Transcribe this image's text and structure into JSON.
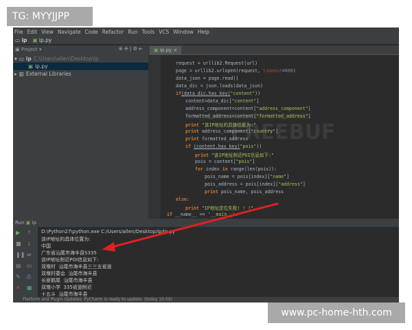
{
  "menu": [
    "File",
    "Edit",
    "View",
    "Navigate",
    "Code",
    "Refactor",
    "Run",
    "Tools",
    "VCS",
    "Window",
    "Help"
  ],
  "nav": {
    "folder": "ip",
    "file": "ip.py"
  },
  "project": {
    "label": "Project",
    "root": "ip",
    "root_path": "C:\\Users\\allen\\Desktop\\ip",
    "file": "ip.py",
    "libs": "External Libraries"
  },
  "editor_tab": "ip.py",
  "code": [
    {
      "i": 1,
      "s": [
        [
          "request = urllib2.Request(url)",
          ""
        ]
      ]
    },
    {
      "i": 1,
      "s": [
        [
          "page = urllib2.urlopen(request, ",
          ""
        ],
        [
          "timeout",
          "param"
        ],
        [
          "=",
          ""
        ],
        [
          "600",
          "num"
        ],
        [
          ")",
          ""
        ]
      ]
    },
    {
      "i": 1,
      "s": [
        [
          "data_json = page.read()",
          ""
        ]
      ]
    },
    {
      "i": 1,
      "s": [
        [
          "data_dic = json.loads(data_json)",
          ""
        ]
      ]
    },
    {
      "i": 1,
      "s": [
        [
          "if",
          "kw"
        ],
        [
          "(data_dic.has_key(",
          "un"
        ],
        [
          "\"content\"",
          "str"
        ],
        [
          "))",
          ""
        ]
      ]
    },
    {
      "i": 2,
      "s": [
        [
          "content=data_dic[",
          ""
        ],
        [
          "\"content\"",
          "str"
        ],
        [
          "]",
          ""
        ]
      ]
    },
    {
      "i": 2,
      "s": [
        [
          "address_component=content[",
          ""
        ],
        [
          "\"address_component\"",
          "str"
        ],
        [
          "]",
          ""
        ]
      ]
    },
    {
      "i": 2,
      "s": [
        [
          "formatted_address=content[",
          ""
        ],
        [
          "\"formatted_address\"",
          "str"
        ],
        [
          "]",
          ""
        ]
      ],
      "hl": true
    },
    {
      "i": 2,
      "s": [
        [
          "print ",
          "kw"
        ],
        [
          "\"该IP地址的具体位置为:\"",
          "str"
        ]
      ]
    },
    {
      "i": 2,
      "s": [
        [
          "print ",
          "kw"
        ],
        [
          "address_component[",
          ""
        ],
        [
          "\"country\"",
          "str"
        ],
        [
          "]",
          ""
        ]
      ]
    },
    {
      "i": 2,
      "s": [
        [
          "print ",
          "kw"
        ],
        [
          "formatted_address",
          ""
        ]
      ]
    },
    {
      "i": 2,
      "s": [
        [
          "if ",
          "kw"
        ],
        [
          "(content.has_key(",
          "un"
        ],
        [
          "\"pois\"",
          "str"
        ],
        [
          "))",
          ""
        ]
      ]
    },
    {
      "i": 3,
      "s": [
        [
          "print ",
          "kw"
        ],
        [
          "\"该IP地址附近POI信息如下:\"",
          "str"
        ]
      ]
    },
    {
      "i": 3,
      "s": [
        [
          "pois = content[",
          ""
        ],
        [
          "\"pois\"",
          "str"
        ],
        [
          "]",
          ""
        ]
      ]
    },
    {
      "i": 3,
      "s": [
        [
          "for ",
          "kw"
        ],
        [
          "index ",
          ""
        ],
        [
          "in ",
          "kw"
        ],
        [
          "range(len(pois)):",
          ""
        ]
      ]
    },
    {
      "i": 4,
      "s": [
        [
          "pois_name = pois[index][",
          ""
        ],
        [
          "\"name\"",
          "str"
        ],
        [
          "]",
          ""
        ]
      ]
    },
    {
      "i": 4,
      "s": [
        [
          "pois_address = pois[index][",
          ""
        ],
        [
          "\"address\"",
          "str"
        ],
        [
          "]",
          ""
        ]
      ]
    },
    {
      "i": 4,
      "s": [
        [
          "print ",
          "kw"
        ],
        [
          "pois_name, pois_address",
          ""
        ]
      ]
    },
    {
      "i": 1,
      "s": [
        [
          "else:",
          "kw"
        ]
      ]
    },
    {
      "i": 2,
      "s": [
        [
          "print ",
          "kw"
        ],
        [
          "\"IP地址定位失败! ! !\"",
          "str"
        ]
      ]
    },
    {
      "i": 0,
      "s": [
        [
          "if ",
          "kw"
        ],
        [
          "__name__ == ",
          ""
        ],
        [
          "'__main__'",
          "str"
        ],
        [
          ":",
          ""
        ]
      ]
    }
  ],
  "run": {
    "label": "Run",
    "config": "ip"
  },
  "console": [
    "D:\\Python27\\python.exe C:/Users/allen/Desktop/ip/ip.py",
    "该IP地址的具体位置为:",
    "中国",
    "广东省汕尾市海丰县S335",
    "该IP地址附近POI信息如下:",
    "双墩村  汕尾市海丰县三三五省道",
    "双墩村委会  汕尾市海丰县",
    "长寮鹅尾  汕尾市海丰县",
    "双墩小学  335省道附近",
    "十五斗  汕尾市海丰县"
  ],
  "status": "Platform and Plugin Updates: PyCharm is ready to update. (today 15:59)",
  "watermarks": {
    "top_left": "TG: MYYJJPP",
    "bottom_right": "www.pc-home-hth.com",
    "center": "FREEBUF"
  },
  "colors": {
    "arrow": "#e02020",
    "background": "#2b2b2b",
    "keyword": "#cc7832",
    "string": "#a5c25c"
  }
}
